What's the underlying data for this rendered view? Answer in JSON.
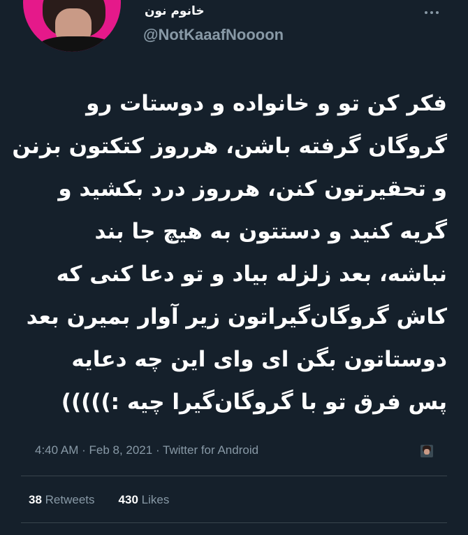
{
  "profile": {
    "display_name": "خانوم نون",
    "username": "@NotKaaafNoooon"
  },
  "tweet": {
    "lines": [
      "فکر کن تو و خانواده و دوستات رو",
      "گروگان گرفته باشن، هرروز کتکتون بزنن",
      "و تحقیرتون کنن، هرروز درد بکشید و",
      "گریه کنید و دستتون به هیچ جا بند",
      "نباشه، بعد زلزله بیاد و تو دعا کنی که",
      "کاش گروگان‌گیراتون زیر آوار بمیرن بعد",
      "دوستاتون بگن ای وای این چه دعایه",
      "پس فرق تو با گروگان‌گیرا چیه :)))))"
    ]
  },
  "meta": {
    "time": "4:40 AM",
    "separator1": " · ",
    "date": "Feb 8, 2021",
    "separator2": " · ",
    "source": "Twitter for Android"
  },
  "stats": {
    "retweets_count": "38",
    "retweets_label": "Retweets",
    "likes_count": "430",
    "likes_label": "Likes"
  },
  "colors": {
    "background": "#15202b",
    "secondary_text": "#8899a6",
    "divider": "#38444d",
    "avatar_bg": "#e5198a"
  }
}
